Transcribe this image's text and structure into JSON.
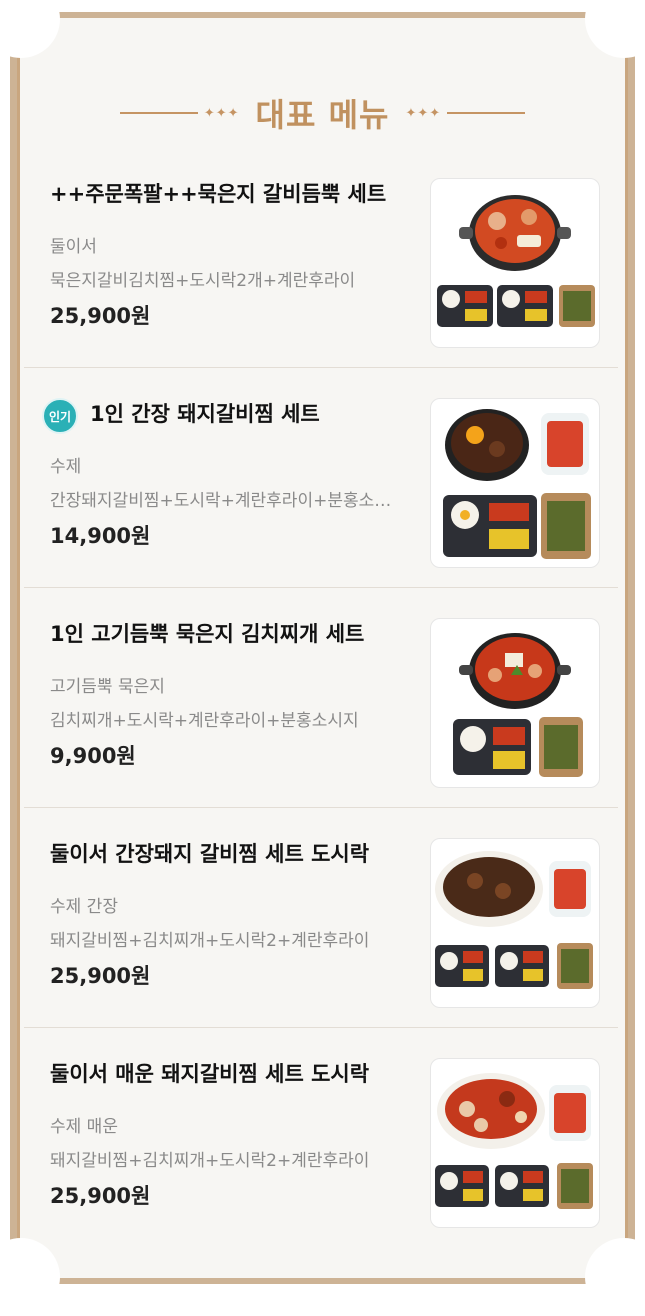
{
  "heading": {
    "title": "대표 메뉴",
    "ornament": "✦✦✦"
  },
  "menu": {
    "items": [
      {
        "badge": "",
        "name": "++주문폭팔++묵은지 갈비듬뿍 세트",
        "description": "둘이서",
        "detail": "묵은지갈비김치찜+도시락2개+계란후라이",
        "price": "25,900원",
        "image": "galbi-kimchi-stew-two-lunchboxes"
      },
      {
        "badge": "인기",
        "name": "1인 간장 돼지갈비찜 세트",
        "description": "수제",
        "detail": "간장돼지갈비찜+도시락+계란후라이+분홍소시지",
        "price": "14,900원",
        "image": "soy-pork-galbi-jjim-set"
      },
      {
        "badge": "",
        "name": "1인 고기듬뿍 묵은지 김치찌개 세트",
        "description": "고기듬뿍 묵은지",
        "detail": "김치찌개+도시락+계란후라이+분홍소시지",
        "price": "9,900원",
        "image": "kimchi-jjigae-set"
      },
      {
        "badge": "",
        "name": "둘이서 간장돼지 갈비찜 세트 도시락",
        "description": "수제 간장",
        "detail": "돼지갈비찜+김치찌개+도시락2+계란후라이",
        "price": "25,900원",
        "image": "soy-galbi-jjim-two-set"
      },
      {
        "badge": "",
        "name": "둘이서 매운 돼지갈비찜 세트 도시락",
        "description": "수제 매운",
        "detail": "돼지갈비찜+김치찌개+도시락2+계란후라이",
        "price": "25,900원",
        "image": "spicy-galbi-jjim-two-set"
      }
    ]
  },
  "colors": {
    "accent": "#c0915f",
    "frame": "#cdb395",
    "badge": "#2ab0b6",
    "price": "#222222",
    "muted": "#8a8a8a"
  }
}
